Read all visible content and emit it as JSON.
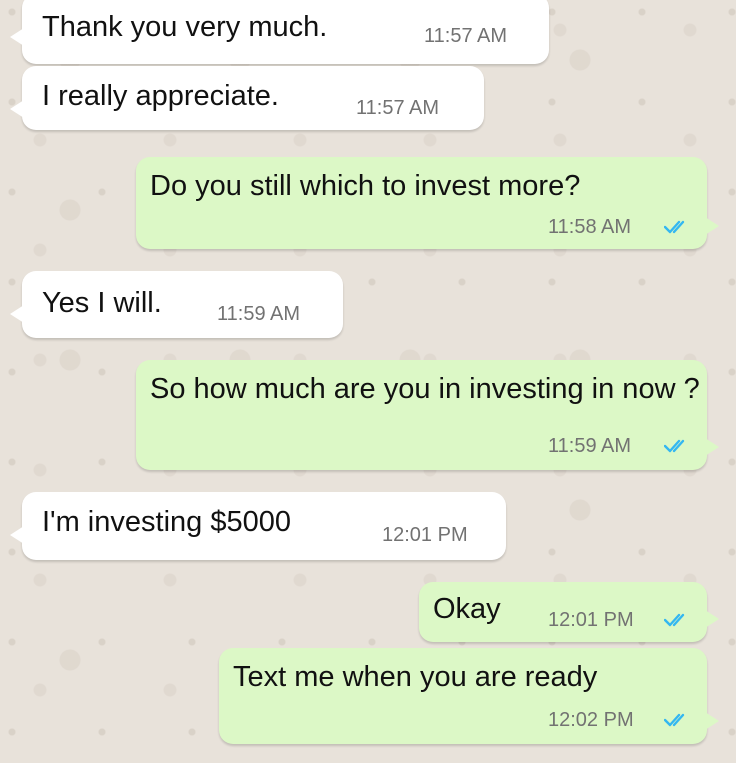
{
  "conversation": {
    "messages": [
      {
        "direction": "incoming",
        "text": "Thank  you very much.",
        "time": "11:57 AM"
      },
      {
        "direction": "incoming",
        "text": "I really appreciate.",
        "time": "11:57 AM"
      },
      {
        "direction": "outgoing",
        "text": "Do you still which to invest more?",
        "time": "11:58 AM",
        "status": "read"
      },
      {
        "direction": "incoming",
        "text": "Yes I will.",
        "time": "11:59 AM"
      },
      {
        "direction": "outgoing",
        "text": "So how much are you in investing in now ?",
        "time": "11:59 AM",
        "status": "read"
      },
      {
        "direction": "incoming",
        "text": "I'm investing $5000",
        "time": "12:01 PM"
      },
      {
        "direction": "outgoing",
        "text": "Okay",
        "time": "12:01 PM",
        "status": "read"
      },
      {
        "direction": "outgoing",
        "text": "Text me when you are ready",
        "time": "12:02 PM",
        "status": "read"
      }
    ]
  },
  "icons": {
    "read_receipt": "double-check-icon"
  },
  "colors": {
    "outgoing_bubble": "#dcf8c6",
    "incoming_bubble": "#ffffff",
    "wallpaper": "#e8e2da",
    "read_tick": "#34b7f1",
    "timestamp": "#727272"
  }
}
